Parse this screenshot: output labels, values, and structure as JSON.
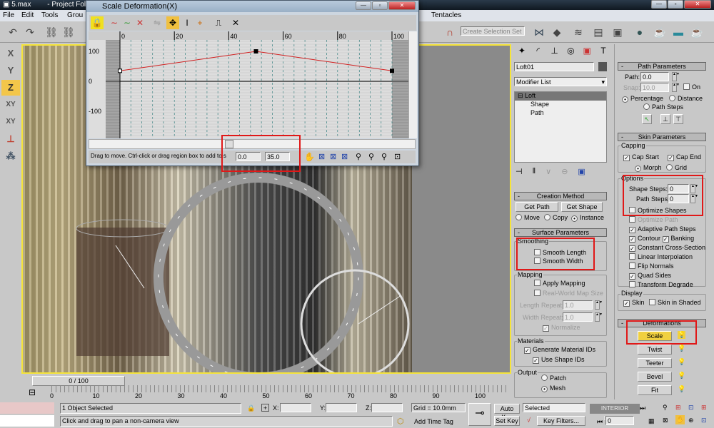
{
  "app": {
    "title": "5.max",
    "title_suffix": "- Project Fold"
  },
  "menu": [
    "File",
    "Edit",
    "Tools",
    "Grou"
  ],
  "menu_right": "Tentacles",
  "toolbar": {
    "selection_set_placeholder": "Create Selection Set"
  },
  "axis_buttons": [
    "X",
    "Y",
    "Z",
    "XY",
    "XY"
  ],
  "active_axis": "Z",
  "dialog": {
    "title": "Scale Deformation(X)",
    "x_ticks": [
      "0",
      "20",
      "40",
      "60",
      "80",
      "100"
    ],
    "y_ticks": [
      "100",
      "0",
      "-100"
    ],
    "curve_points": [
      {
        "x": 0,
        "y": 35
      },
      {
        "x": 50,
        "y": 100
      },
      {
        "x": 100,
        "y": 35
      }
    ],
    "status_text": "Drag to move. Ctrl-click or drag region box to add to s",
    "position_value": "0.0",
    "amount_value": "35.0",
    "curve_color": "#d02020"
  },
  "command_panel": {
    "object_name": "Loft01",
    "modifier_list": "Modifier List",
    "stack": [
      {
        "label": "Loft"
      },
      {
        "label": "Shape"
      },
      {
        "label": "Path"
      }
    ],
    "creation_method": {
      "title": "Creation Method",
      "get_path": "Get Path",
      "get_shape": "Get Shape",
      "radios": [
        {
          "label": "Move",
          "checked": false
        },
        {
          "label": "Copy",
          "checked": false
        },
        {
          "label": "Instance",
          "checked": true
        }
      ]
    },
    "surface_parameters": {
      "title": "Surface Parameters",
      "smoothing_label": "Smoothing",
      "smooth_length": "Smooth Length",
      "smooth_width": "Smooth Width",
      "mapping_label": "Mapping",
      "apply_mapping": "Apply Mapping",
      "real_world": "Real-World Map Size",
      "length_repeat_label": "Length Repeat:",
      "length_repeat": "1.0",
      "width_repeat_label": "Width Repeat:",
      "width_repeat": "1.0",
      "normalize": "Normalize",
      "materials_label": "Materials",
      "gen_mat_ids": "Generate Material IDs",
      "use_shape_ids": "Use Shape IDs",
      "output_label": "Output",
      "patch": "Patch",
      "mesh": "Mesh"
    }
  },
  "path_parameters": {
    "title": "Path Parameters",
    "path_label": "Path:",
    "path_value": "0.0",
    "snap_label": "Snap:",
    "snap_value": "10.0",
    "on_label": "On",
    "percentage": "Percentage",
    "distance": "Distance",
    "path_steps": "Path Steps"
  },
  "skin_parameters": {
    "title": "Skin Parameters",
    "capping_label": "Capping",
    "cap_start": "Cap Start",
    "cap_end": "Cap End",
    "morph": "Morph",
    "grid": "Grid",
    "options_label": "Options",
    "shape_steps_label": "Shape Steps:",
    "shape_steps": "0",
    "path_steps_label": "Path Steps:",
    "path_steps": "0",
    "checks": [
      {
        "label": "Optimize Shapes",
        "checked": false,
        "disabled": false
      },
      {
        "label": "Optimize Path",
        "checked": false,
        "disabled": true
      },
      {
        "label": "Adaptive Path Steps",
        "checked": true,
        "disabled": false
      },
      {
        "label": "Contour",
        "checked": true,
        "disabled": false
      },
      {
        "label": "Constant Cross-Section",
        "checked": true,
        "disabled": false
      },
      {
        "label": "Linear Interpolation",
        "checked": false,
        "disabled": false
      },
      {
        "label": "Flip Normals",
        "checked": false,
        "disabled": false
      },
      {
        "label": "Quad Sides",
        "checked": true,
        "disabled": false
      },
      {
        "label": "Transform Degrade",
        "checked": false,
        "disabled": false
      }
    ],
    "banking": "Banking",
    "display_label": "Display",
    "skin": "Skin",
    "skin_in_shaded": "Skin in Shaded"
  },
  "deformations": {
    "title": "Deformations",
    "buttons": [
      "Scale",
      "Twist",
      "Teeter",
      "Bevel",
      "Fit"
    ],
    "active": "Scale",
    "active_color": "#f0d040"
  },
  "timeline": {
    "frame_label": "0 / 100",
    "ticks": [
      "0",
      "10",
      "20",
      "30",
      "40",
      "50",
      "60",
      "70",
      "80",
      "90",
      "100"
    ]
  },
  "status": {
    "selection": "1 Object Selected",
    "prompt": "Click and drag to pan a non-camera view",
    "x_label": "X:",
    "y_label": "Y:",
    "z_label": "Z:",
    "grid": "Grid = 10.0mm",
    "add_time_tag": "Add Time Tag",
    "auto_key": "Auto Key",
    "set_key": "Set Key",
    "key_mode": "Selected",
    "key_filters": "Key Filters...",
    "frame_value": "0",
    "watermark": "INTERIOR DESIGN"
  }
}
